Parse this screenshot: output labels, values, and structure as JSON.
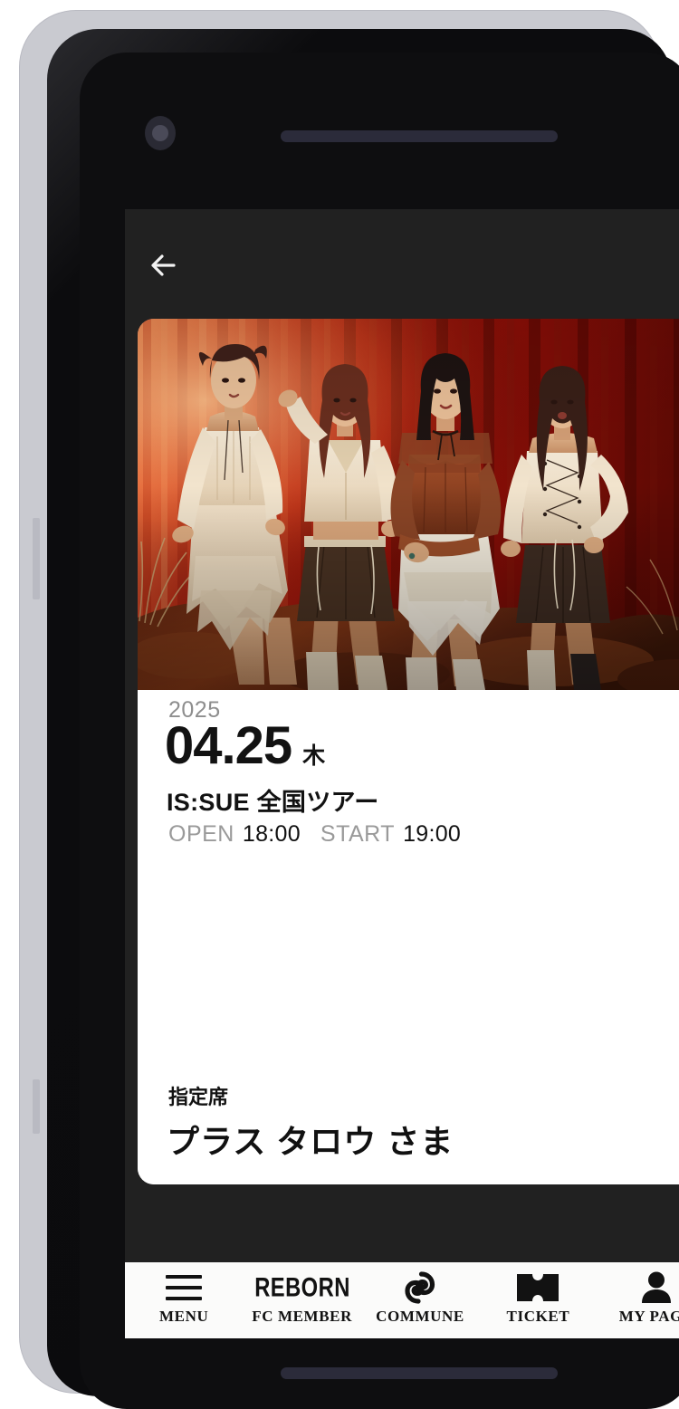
{
  "device": {
    "camera_icon": "camera-hole",
    "earpiece_icon": "earpiece-speaker",
    "home_indicator_icon": "home-indicator"
  },
  "header": {
    "back_icon": "back-arrow-icon",
    "back_label": "Back"
  },
  "ticket": {
    "photo_alt": "artist-group-photo",
    "year": "2025",
    "date": "04.25",
    "day_of_week": "木",
    "event_title": "IS:SUE 全国ツアー",
    "open_label": "OPEN",
    "open_time": "18:00",
    "start_label": "START",
    "start_time": "19:00",
    "seat_type": "指定席",
    "holder_name": "プラス タロウ さま"
  },
  "bottom_nav": {
    "items": [
      {
        "label": "MENU",
        "icon": "hamburger-menu-icon"
      },
      {
        "label": "FC MEMBER",
        "icon": "reborn-logo-icon",
        "logo_text": "REBORN"
      },
      {
        "label": "COMMUNE",
        "icon": "commune-swirl-icon"
      },
      {
        "label": "TICKET",
        "icon": "ticket-icon"
      },
      {
        "label": "MY PAGE",
        "icon": "person-icon"
      }
    ]
  },
  "colors": {
    "app_background": "#212121",
    "card_background": "#ffffff",
    "nav_background": "#fbfbfa",
    "text_primary": "#121212",
    "text_muted": "#8e8e8e",
    "device_frame": "#c9cad0"
  }
}
